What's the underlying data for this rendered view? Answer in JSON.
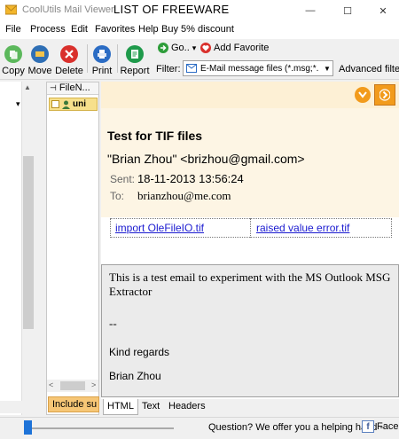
{
  "window": {
    "app_name": "CoolUtils Mail Viewer",
    "document_title": "LIST OF FREEWARE",
    "controls": {
      "minimize": "—",
      "maximize": "☐",
      "close": "✕"
    }
  },
  "menu": [
    "File",
    "Process",
    "Edit",
    "Favorites",
    "Help",
    "Buy 5% discount"
  ],
  "toolbar": {
    "tools": [
      {
        "label": "Copy",
        "icon": "copy-icon",
        "color": "#5cb85c"
      },
      {
        "label": "Move",
        "icon": "move-icon",
        "color": "#2f6fb5"
      },
      {
        "label": "Delete",
        "icon": "delete-icon",
        "color": "#d9302c"
      },
      {
        "label": "Print",
        "icon": "print-icon",
        "color": "#2b6cc4"
      },
      {
        "label": "Report",
        "icon": "report-icon",
        "color": "#1f9a4b"
      }
    ],
    "go_label": "Go..",
    "go_arrow": "▾",
    "add_favorite_label": "Add Favorite",
    "filter_label": "Filter:",
    "filter_value": "E-Mail message files (*.msg;*.em",
    "filter_arrow": "▼",
    "advanced_filter_label": "Advanced filter"
  },
  "folder_pane": {
    "arrow": "▲",
    "marker": "▾"
  },
  "file_list": {
    "header": "FileN...",
    "header_pin": "⊣",
    "selected_row": "uni",
    "include_button": "Include su",
    "scroll_left": "<",
    "scroll_right": ">"
  },
  "message": {
    "subject": "Test for TIF files",
    "from": "\"Brian Zhou\" <brizhou@gmail.com>",
    "sent_label": "Sent:",
    "sent_value": "18-11-2013 13:56:24",
    "to_label": "To:",
    "to_value": "brianzhou@me.com",
    "attachments": [
      "import OleFileIO.tif",
      "raised value error.tif"
    ],
    "body": "This is a test email to experiment with the MS Outlook MSG Extractor",
    "signature_dash": "--",
    "regards": "Kind regards",
    "signature_name": "Brian Zhou"
  },
  "view_tabs": [
    "HTML",
    "Text",
    "Headers"
  ],
  "status_bar": {
    "question": "Question? We offer you a helping hand -",
    "facebook": "Facebo",
    "facebook_glyph": "f"
  },
  "colors": {
    "accent_orange": "#f29b1c",
    "link_blue": "#1a1ad0",
    "selection_yellow": "#f7e08c",
    "header_bg": "#fdf5e4"
  }
}
